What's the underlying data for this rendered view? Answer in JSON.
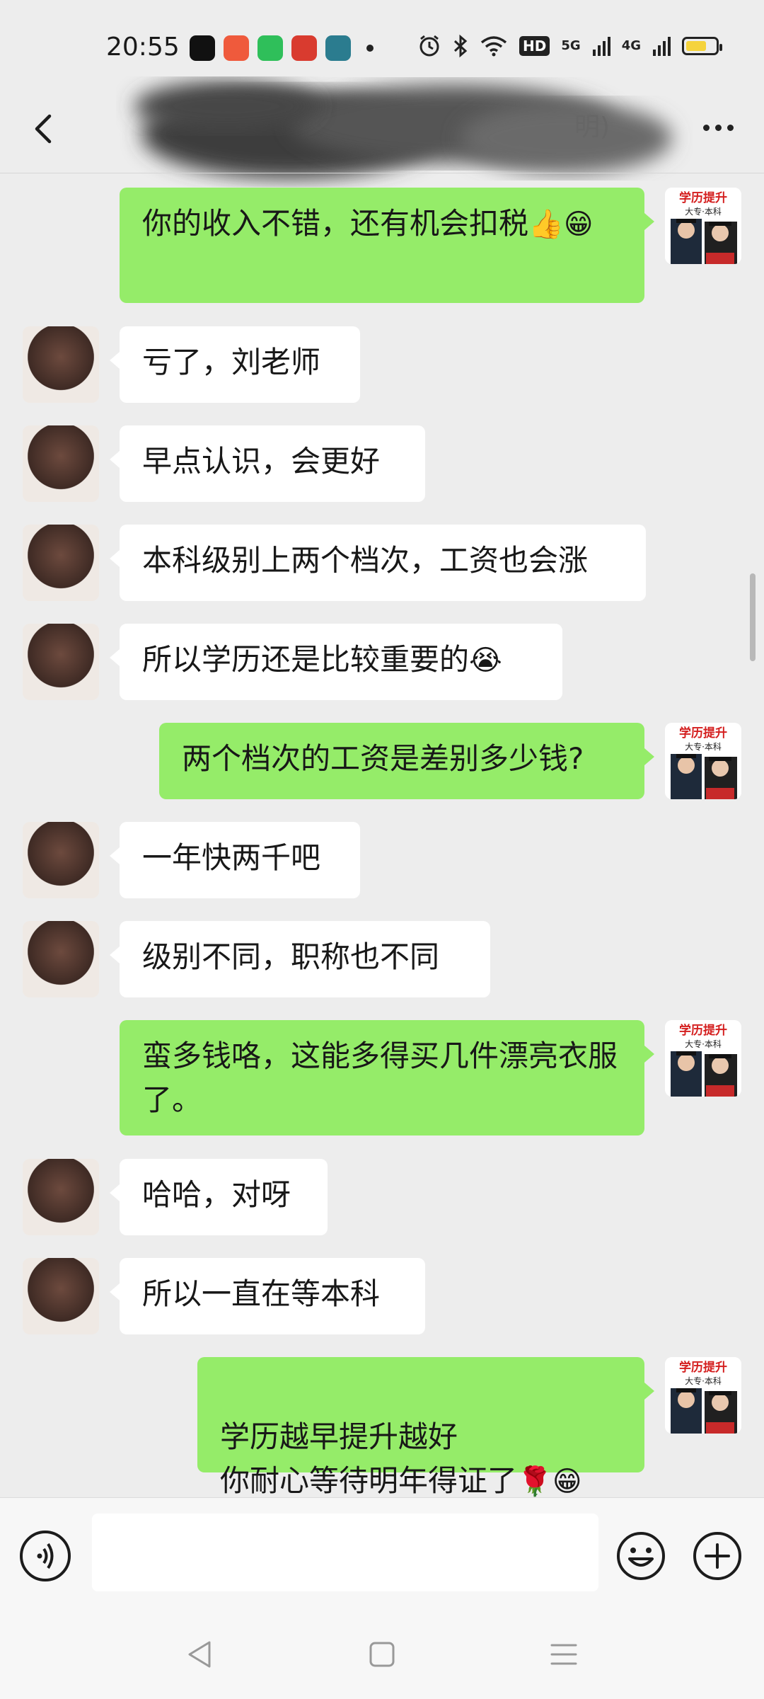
{
  "status_bar": {
    "time": "20:55",
    "app_icons": [
      {
        "name": "tiktok-app-icon",
        "color": "#111111"
      },
      {
        "name": "app-icon-orange",
        "color": "#ef5a3c"
      },
      {
        "name": "app-icon-green",
        "color": "#2fbf5a"
      },
      {
        "name": "app-icon-red",
        "color": "#d93b2f"
      },
      {
        "name": "app-icon-teal",
        "color": "#2b7c8f"
      }
    ],
    "hd_label": "HD",
    "network_1": "5G",
    "network_2": "4G",
    "battery_color": "#f5d33c"
  },
  "title_bar": {
    "title_visible_suffix": "明)"
  },
  "messages": [
    {
      "side": "out",
      "text": "你的收入不错，还有机会扣税",
      "emoji": "👍😁"
    },
    {
      "side": "in",
      "text": "亏了，刘老师",
      "emoji": ""
    },
    {
      "side": "in",
      "text": "早点认识，会更好",
      "emoji": ""
    },
    {
      "side": "in",
      "text": "本科级别上两个档次，工资也会涨",
      "emoji": ""
    },
    {
      "side": "in",
      "text": "所以学历还是比较重要的",
      "emoji": "😭"
    },
    {
      "side": "out",
      "text": "两个档次的工资是差别多少钱?",
      "emoji": ""
    },
    {
      "side": "in",
      "text": "一年快两千吧",
      "emoji": ""
    },
    {
      "side": "in",
      "text": "级别不同，职称也不同",
      "emoji": ""
    },
    {
      "side": "out",
      "text": "蛮多钱咯，这能多得买几件漂亮衣服了。",
      "emoji": ""
    },
    {
      "side": "in",
      "text": "哈哈，对呀",
      "emoji": ""
    },
    {
      "side": "in",
      "text": "所以一直在等本科",
      "emoji": ""
    },
    {
      "side": "out",
      "text": "学历越早提升越好\n你耐心等待明年得证了",
      "emoji": "🌹😁"
    }
  ],
  "my_avatar": {
    "line1": "学历提升",
    "line2": "大专·本科",
    "accent_color": "#d41e1e"
  },
  "colors": {
    "background": "#ededed",
    "outgoing_bubble": "#95ec69",
    "incoming_bubble": "#ffffff"
  },
  "input_bar": {
    "placeholder": ""
  }
}
